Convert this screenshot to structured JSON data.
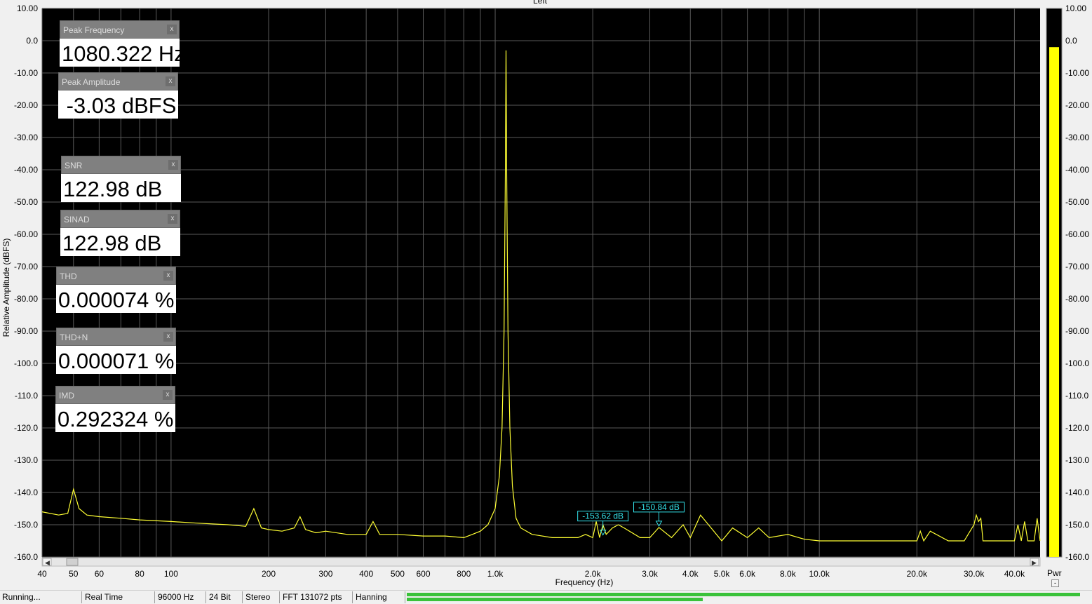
{
  "chart_title": "Left",
  "axes": {
    "ylabel": "Relative Amplitude (dBFS)",
    "xlabel": "Frequency (Hz)",
    "y_ticks": [
      "10.00",
      "0.0",
      "-10.00",
      "-20.00",
      "-30.00",
      "-40.00",
      "-50.00",
      "-60.00",
      "-70.00",
      "-80.00",
      "-90.00",
      "-100.0",
      "-110.0",
      "-120.0",
      "-130.0",
      "-140.0",
      "-150.0",
      "-160.0"
    ],
    "x_ticks": [
      {
        "f": 40,
        "t": "40"
      },
      {
        "f": 50,
        "t": "50"
      },
      {
        "f": 60,
        "t": "60"
      },
      {
        "f": 80,
        "t": "80"
      },
      {
        "f": 100,
        "t": "100"
      },
      {
        "f": 200,
        "t": "200"
      },
      {
        "f": 300,
        "t": "300"
      },
      {
        "f": 400,
        "t": "400"
      },
      {
        "f": 500,
        "t": "500"
      },
      {
        "f": 600,
        "t": "600"
      },
      {
        "f": 800,
        "t": "800"
      },
      {
        "f": 1000,
        "t": "1.0k"
      },
      {
        "f": 2000,
        "t": "2.0k"
      },
      {
        "f": 3000,
        "t": "3.0k"
      },
      {
        "f": 4000,
        "t": "4.0k"
      },
      {
        "f": 5000,
        "t": "5.0k"
      },
      {
        "f": 6000,
        "t": "6.0k"
      },
      {
        "f": 8000,
        "t": "8.0k"
      },
      {
        "f": 10000,
        "t": "10.0k"
      },
      {
        "f": 20000,
        "t": "20.0k"
      },
      {
        "f": 30000,
        "t": "30.0k"
      },
      {
        "f": 40000,
        "t": "40.0k"
      }
    ],
    "pwr_ticks": [
      "10.00",
      "0.0",
      "-10.00",
      "-20.00",
      "-30.00",
      "-40.00",
      "-50.00",
      "-60.00",
      "-70.00",
      "-80.00",
      "-90.00",
      "-100.0",
      "-110.0",
      "-120.0",
      "-130.0",
      "-140.0",
      "-150.0",
      "-160.0"
    ],
    "pwr_label": "Pwr"
  },
  "chart_data": {
    "type": "line",
    "xlabel": "Frequency (Hz)",
    "ylabel": "Relative Amplitude (dBFS)",
    "x_scale": "log",
    "xlim": [
      40,
      48000
    ],
    "ylim": [
      -160,
      10
    ],
    "grid": true,
    "series": [
      {
        "color": "#ffff33",
        "x": [
          40,
          45,
          48,
          50,
          52,
          55,
          60,
          70,
          80,
          100,
          120,
          150,
          170,
          180,
          190,
          200,
          220,
          240,
          250,
          260,
          280,
          300,
          350,
          400,
          420,
          440,
          500,
          600,
          700,
          800,
          850,
          900,
          950,
          1000,
          1030,
          1050,
          1065,
          1075,
          1080.322,
          1085,
          1095,
          1110,
          1130,
          1160,
          1200,
          1300,
          1500,
          1700,
          1800,
          1900,
          2000,
          2050,
          2100,
          2150,
          2200,
          2300,
          2400,
          2500,
          2800,
          3000,
          3200,
          3500,
          3800,
          4000,
          4300,
          5000,
          5400,
          6000,
          6500,
          7000,
          8000,
          9000,
          10000,
          12000,
          15000,
          18000,
          20000,
          20500,
          21000,
          22000,
          25000,
          28000,
          30000,
          30500,
          31000,
          31500,
          32000,
          35000,
          38000,
          40000,
          41000,
          42000,
          43000,
          44000,
          46000,
          47000,
          48000
        ],
        "y": [
          -146,
          -147,
          -146.5,
          -139,
          -145,
          -147,
          -147.5,
          -148,
          -148.5,
          -149,
          -149.5,
          -150,
          -150.5,
          -145,
          -151,
          -151.5,
          -152,
          -151,
          -147.5,
          -151.5,
          -152.5,
          -152,
          -153,
          -153,
          -149,
          -153,
          -153,
          -153.5,
          -153.5,
          -154,
          -153,
          -152,
          -150,
          -145,
          -135,
          -120,
          -90,
          -40,
          -3.03,
          -40,
          -90,
          -120,
          -138,
          -148,
          -151,
          -153,
          -154,
          -154,
          -154,
          -153,
          -154,
          -149,
          -154,
          -150,
          -153,
          -151,
          -150,
          -151,
          -154,
          -154,
          -150.84,
          -154,
          -150,
          -154,
          -147,
          -155,
          -151,
          -154,
          -151,
          -154,
          -153,
          -154.5,
          -155,
          -155,
          -155,
          -155,
          -155,
          -152,
          -155,
          -152,
          -155,
          -155,
          -150,
          -147,
          -149,
          -148,
          -155,
          -155,
          -155,
          -155,
          -150,
          -155,
          -149,
          -155,
          -155,
          -148,
          -155
        ]
      }
    ],
    "markers": [
      {
        "x": 2150,
        "y": -153.62,
        "label": "-153.62 dB"
      },
      {
        "x": 3200,
        "y": -150.84,
        "label": "-150.84 dB"
      }
    ]
  },
  "widgets": [
    {
      "title": "Peak Frequency",
      "value": "1080.322 Hz",
      "close": "x"
    },
    {
      "title": "Peak Amplitude",
      "value": " -3.03 dBFS",
      "close": "x"
    },
    {
      "title": "SNR",
      "value": "122.98 dB",
      "close": "x"
    },
    {
      "title": "SINAD",
      "value": "122.98 dB",
      "close": "x"
    },
    {
      "title": "THD",
      "value": "0.000074 %",
      "close": "x"
    },
    {
      "title": "THD+N",
      "value": "0.000071 %",
      "close": "x"
    },
    {
      "title": "IMD",
      "value": "0.292324 %",
      "close": "x"
    }
  ],
  "power_meter": {
    "level_db": -2.0
  },
  "colors": {
    "trace": "#ffff33",
    "grid": "#5a5a5a",
    "plot_bg": "#000000",
    "marker": "#33e0e8",
    "meter": "#3ac23a"
  },
  "status": {
    "state": "Running...",
    "mode": "Real Time",
    "rate": "96000 Hz",
    "bits": "24 Bit",
    "channels": "Stereo",
    "fft": "FFT 131072 pts",
    "window": "Hanning"
  },
  "meters": {
    "left_level": 1.0,
    "right_level": 0.44
  }
}
